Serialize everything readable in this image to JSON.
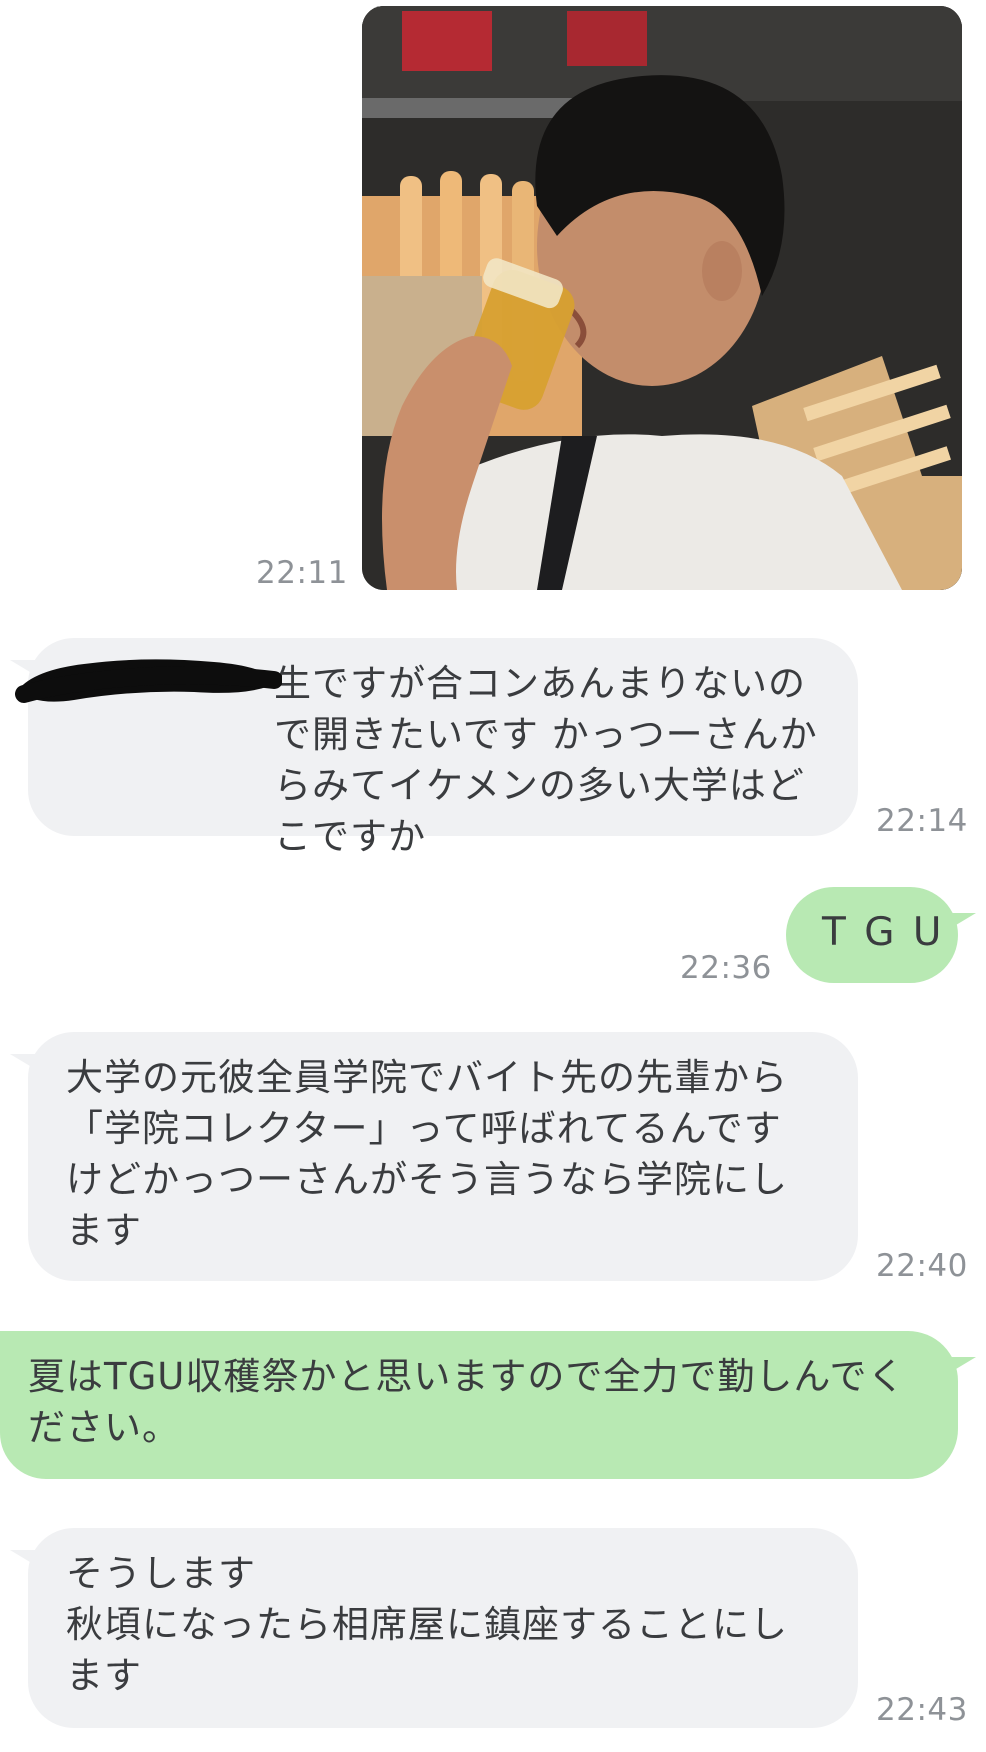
{
  "messages": [
    {
      "id": "m1",
      "type": "image",
      "direction": "outgoing",
      "time": "22:11",
      "image_desc": "photo-young-man-drinking-beer"
    },
    {
      "id": "m2",
      "type": "text",
      "direction": "incoming",
      "time": "22:14",
      "text": "生ですが合コンあんまりないので開きたいです かっつーさんからみてイケメンの多い大学はどこですか",
      "redacted_prefix": true
    },
    {
      "id": "m3",
      "type": "text",
      "direction": "outgoing",
      "time": "22:36",
      "text": "T G U"
    },
    {
      "id": "m4",
      "type": "text",
      "direction": "incoming",
      "time": "22:40",
      "text": "大学の元彼全員学院でバイト先の先輩から「学院コレクター」って呼ばれてるんですけどかっつーさんがそう言うなら学院にします"
    },
    {
      "id": "m5",
      "type": "text",
      "direction": "outgoing",
      "time": "",
      "text": "夏はTGU収穫祭かと思いますので全力で勤しんでください。"
    },
    {
      "id": "m6",
      "type": "text",
      "direction": "incoming",
      "time": "22:43",
      "text": "そうします\n秋頃になったら相席屋に鎮座することにします"
    }
  ],
  "colors": {
    "incoming_bubble": "#f0f1f3",
    "outgoing_bubble": "#b8e9b3",
    "timestamp": "#8e9297",
    "text": "#3a3c3f"
  }
}
